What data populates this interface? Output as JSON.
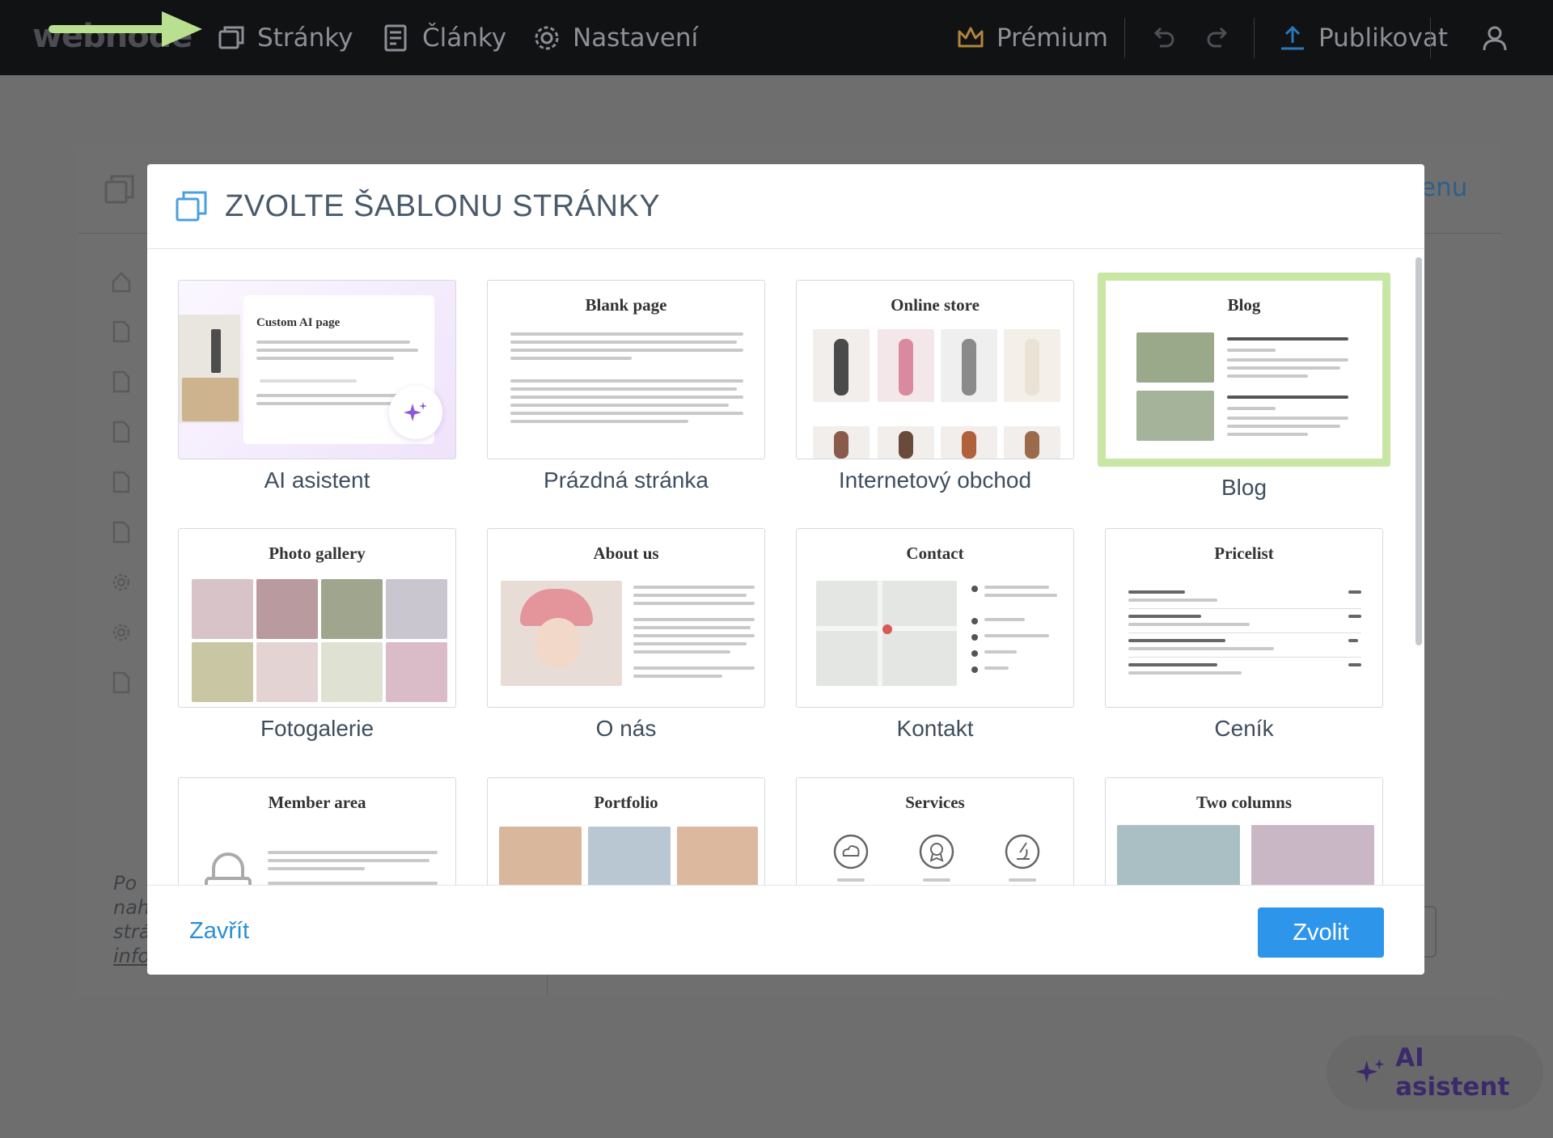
{
  "topbar": {
    "logo": "webnode",
    "nav": [
      {
        "label": "Stránky",
        "icon": "pages-icon"
      },
      {
        "label": "Články",
        "icon": "articles-icon"
      },
      {
        "label": "Nastavení",
        "icon": "gear-icon"
      }
    ],
    "premium": "Prémium",
    "publish": "Publikovat",
    "accent": "#e0a84a"
  },
  "background": {
    "menu_fragment": "enu",
    "italic_lines": [
      "Po",
      "nah",
      "strá",
      "info"
    ],
    "ai_button": "AI asistent"
  },
  "modal": {
    "title": "ZVOLTE ŠABLONU STRÁNKY",
    "templates": [
      {
        "thumb_title": "Custom AI page",
        "label": "AI asistent",
        "selected": false
      },
      {
        "thumb_title": "Blank page",
        "label": "Prázdná stránka",
        "selected": false
      },
      {
        "thumb_title": "Online store",
        "label": "Internetový obchod",
        "selected": false
      },
      {
        "thumb_title": "Blog",
        "label": "Blog",
        "selected": true
      },
      {
        "thumb_title": "Photo gallery",
        "label": "Fotogalerie",
        "selected": false
      },
      {
        "thumb_title": "About us",
        "label": "O nás",
        "selected": false
      },
      {
        "thumb_title": "Contact",
        "label": "Kontakt",
        "selected": false
      },
      {
        "thumb_title": "Pricelist",
        "label": "Ceník",
        "selected": false
      },
      {
        "thumb_title": "Member area",
        "label": "",
        "selected": false
      },
      {
        "thumb_title": "Portfolio",
        "label": "",
        "selected": false
      },
      {
        "thumb_title": "Services",
        "label": "",
        "selected": false
      },
      {
        "thumb_title": "Two columns",
        "label": "",
        "selected": false
      }
    ],
    "close_label": "Zavřít",
    "choose_label": "Zvolit",
    "colors": {
      "primary": "#2d96ea",
      "link": "#2a8fd6",
      "selected_border": "#c8e6a4"
    }
  }
}
